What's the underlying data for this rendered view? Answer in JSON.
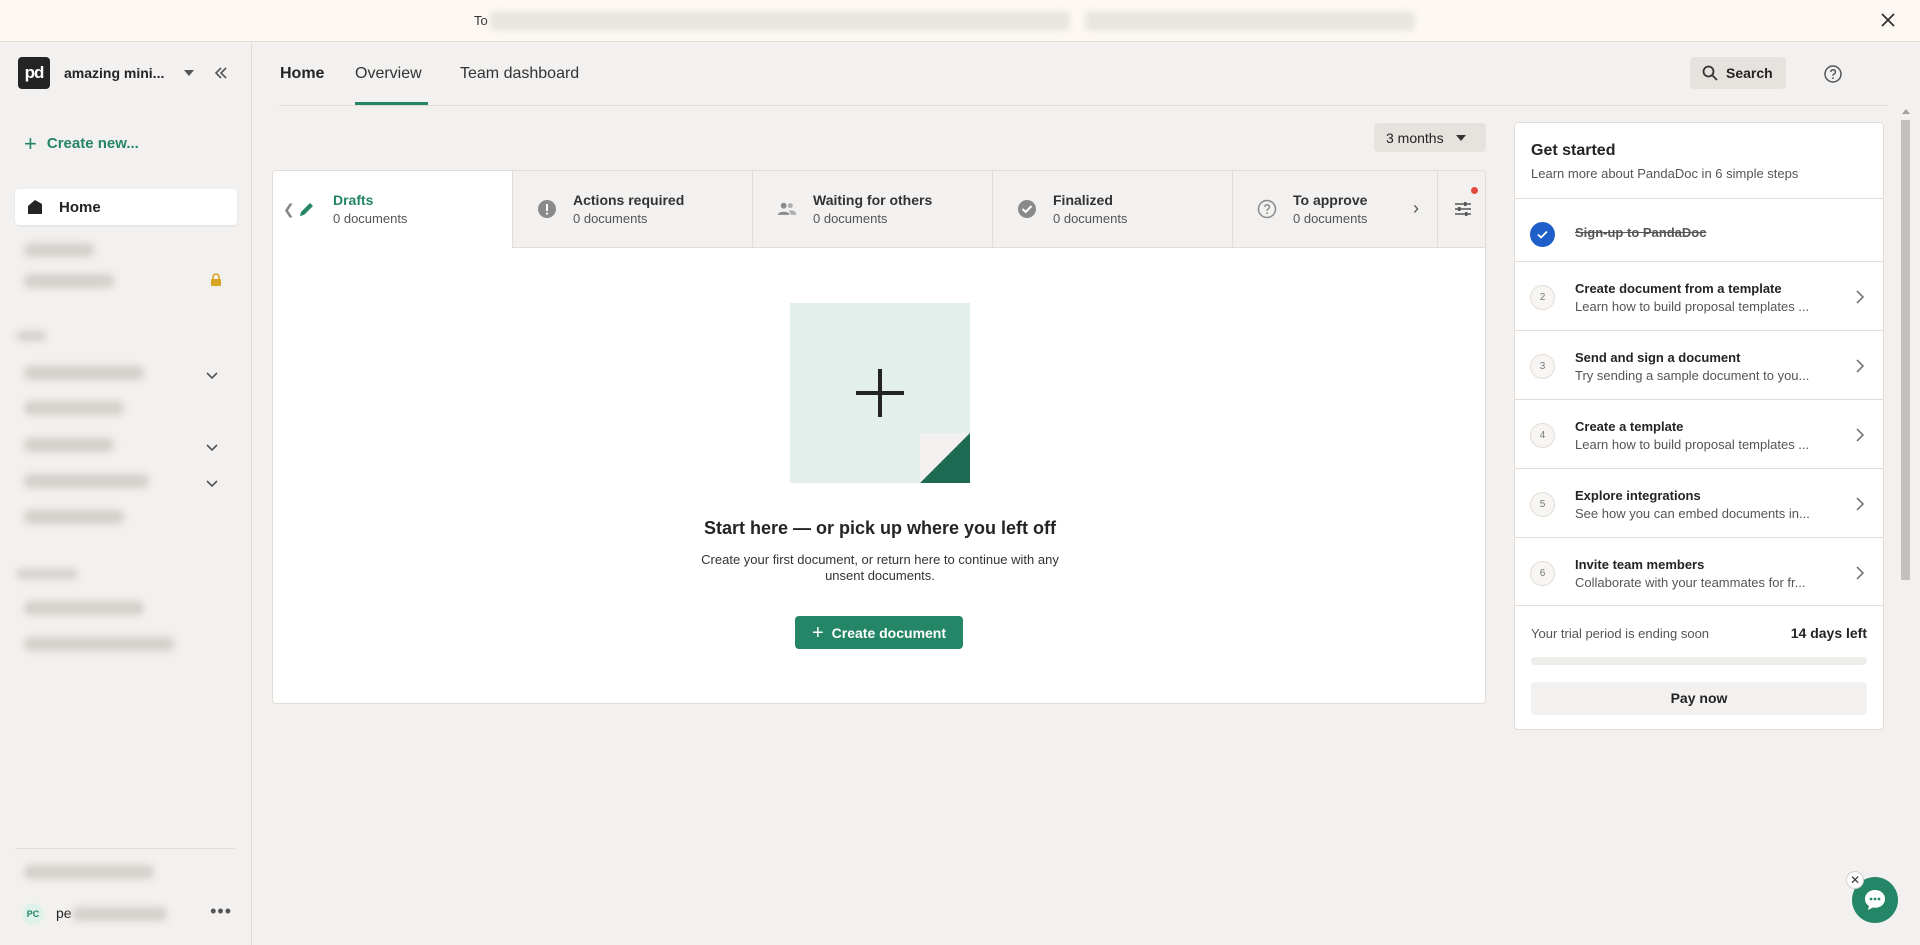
{
  "banner": {
    "text": "To"
  },
  "sidebar": {
    "workspace_logo": "pd",
    "workspace_name": "amazing mini...",
    "create_new": "Create new...",
    "home_label": "Home",
    "user_initials": "PC",
    "user_name": "pe"
  },
  "header": {
    "tabs": [
      {
        "label": "Home"
      },
      {
        "label": "Overview"
      },
      {
        "label": "Team dashboard"
      }
    ],
    "search_label": "Search"
  },
  "period": {
    "label": "3 months"
  },
  "statuses": [
    {
      "title": "Drafts",
      "count": "0 documents",
      "icon": "pencil-icon"
    },
    {
      "title": "Actions required",
      "count": "0 documents",
      "icon": "alert-icon"
    },
    {
      "title": "Waiting for others",
      "count": "0 documents",
      "icon": "people-icon"
    },
    {
      "title": "Finalized",
      "count": "0 documents",
      "icon": "check-circle-icon"
    },
    {
      "title": "To approve",
      "count": "0 documents",
      "icon": "question-icon"
    }
  ],
  "empty_state": {
    "title": "Start here — or pick up where you left off",
    "subtitle": "Create your first document, or return here to continue with any unsent documents.",
    "button": "Create document"
  },
  "get_started": {
    "title": "Get started",
    "subtitle": "Learn more about PandaDoc in 6 simple steps",
    "steps": [
      {
        "num": "1",
        "title": "Sign-up to PandaDoc",
        "desc": "",
        "done": true
      },
      {
        "num": "2",
        "title": "Create document from a template",
        "desc": "Learn how to build proposal templates ...",
        "done": false
      },
      {
        "num": "3",
        "title": "Send and sign a document",
        "desc": "Try sending a sample document to you...",
        "done": false
      },
      {
        "num": "4",
        "title": "Create a template",
        "desc": "Learn how to build proposal templates ...",
        "done": false
      },
      {
        "num": "5",
        "title": "Explore integrations",
        "desc": "See how you can embed documents in...",
        "done": false
      },
      {
        "num": "6",
        "title": "Invite team members",
        "desc": "Collaborate with your teammates for fr...",
        "done": false
      }
    ],
    "trial_text": "Your trial period is ending soon",
    "trial_days": "14 days left",
    "pay_label": "Pay now"
  },
  "colors": {
    "accent": "#248567",
    "background": "#f3f1ef",
    "notification": "#e24c3e",
    "done_step": "#1f5fc9"
  }
}
